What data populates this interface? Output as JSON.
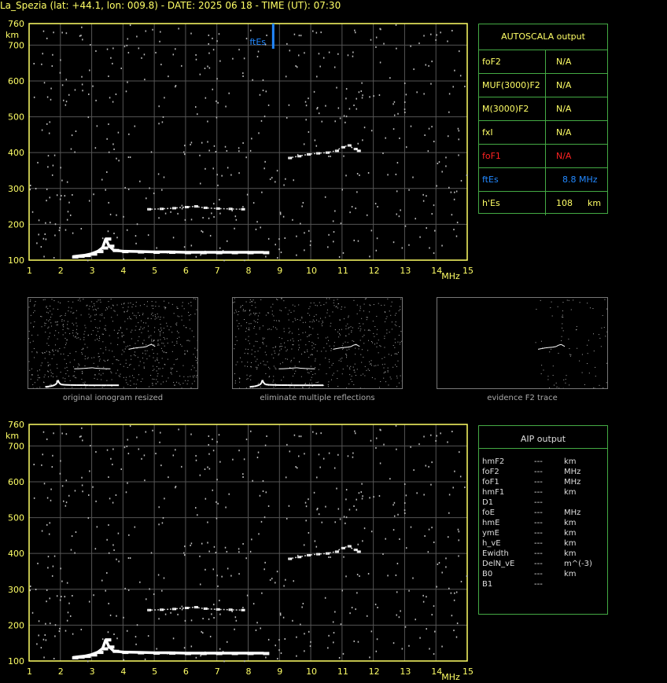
{
  "title": "La_Spezia (lat: +44.1, lon: 009.8) - DATE: 2025 06 18 - TIME (UT): 07:30",
  "colors": {
    "axis": "#ffff66",
    "grid": "#555555",
    "panel_border": "#44aa44",
    "fEs_marker": "#2288ff",
    "foF1_red": "#ff2222"
  },
  "chart_data": [
    {
      "type": "scatter",
      "title": "",
      "xlabel": "MHz",
      "ylabel": "km",
      "xlim": [
        1,
        15
      ],
      "ylim": [
        100,
        760
      ],
      "x_ticks": [
        1,
        2,
        3,
        4,
        5,
        6,
        7,
        8,
        9,
        10,
        11,
        12,
        13,
        14,
        15
      ],
      "y_ticks": [
        100,
        200,
        300,
        400,
        500,
        600,
        700,
        760
      ],
      "grid": true,
      "annotation": {
        "label": "ftEs",
        "x": 8.8
      },
      "series": [
        {
          "trace": "E",
          "x": [
            2.4,
            2.6,
            2.8,
            3.0,
            3.2,
            3.35,
            3.45,
            3.55,
            3.7,
            4.0,
            4.5,
            5.0,
            5.5,
            6.0,
            6.5,
            7.0,
            7.5,
            8.0,
            8.5
          ],
          "y": [
            110,
            112,
            114,
            118,
            125,
            135,
            160,
            140,
            128,
            125,
            124,
            123,
            123,
            122,
            122,
            122,
            122,
            122,
            122
          ]
        },
        {
          "trace": "E2",
          "x": [
            4.8,
            5.2,
            5.6,
            6.0,
            6.3,
            6.6,
            7.0,
            7.4,
            7.8
          ],
          "y": [
            242,
            243,
            245,
            248,
            250,
            246,
            244,
            243,
            242
          ]
        },
        {
          "trace": "F2",
          "x": [
            9.3,
            9.6,
            9.9,
            10.2,
            10.5,
            10.8,
            11.0,
            11.2,
            11.4,
            11.5
          ],
          "y": [
            385,
            390,
            395,
            398,
            400,
            405,
            415,
            420,
            410,
            405
          ]
        }
      ]
    },
    {
      "type": "scatter",
      "title": "",
      "xlabel": "MHz",
      "ylabel": "km",
      "xlim": [
        1,
        15
      ],
      "ylim": [
        100,
        760
      ],
      "x_ticks": [
        1,
        2,
        3,
        4,
        5,
        6,
        7,
        8,
        9,
        10,
        11,
        12,
        13,
        14,
        15
      ],
      "y_ticks": [
        100,
        200,
        300,
        400,
        500,
        600,
        700,
        760
      ],
      "grid": true,
      "series": [
        {
          "trace": "E",
          "x": [
            2.4,
            2.6,
            2.8,
            3.0,
            3.2,
            3.35,
            3.45,
            3.55,
            3.7,
            4.0,
            4.5,
            5.0,
            5.5,
            6.0,
            6.5,
            7.0,
            7.5,
            8.0,
            8.5
          ],
          "y": [
            110,
            112,
            114,
            118,
            125,
            135,
            160,
            140,
            128,
            125,
            124,
            123,
            123,
            122,
            122,
            122,
            122,
            122,
            122
          ]
        },
        {
          "trace": "E2",
          "x": [
            4.8,
            5.2,
            5.6,
            6.0,
            6.3,
            6.6,
            7.0,
            7.4,
            7.8
          ],
          "y": [
            242,
            243,
            245,
            248,
            250,
            246,
            244,
            243,
            242
          ]
        },
        {
          "trace": "F2",
          "x": [
            9.3,
            9.6,
            9.9,
            10.2,
            10.5,
            10.8,
            11.0,
            11.2,
            11.4,
            11.5
          ],
          "y": [
            385,
            390,
            395,
            398,
            400,
            405,
            415,
            420,
            410,
            405
          ]
        }
      ]
    }
  ],
  "autoscala": {
    "header": "AUTOSCALA output",
    "rows": [
      {
        "key": "foF2",
        "value": "N/A",
        "unit": "",
        "color": "#ffff66"
      },
      {
        "key": "MUF(3000)F2",
        "value": "N/A",
        "unit": "",
        "color": "#ffff66"
      },
      {
        "key": "M(3000)F2",
        "value": "N/A",
        "unit": "",
        "color": "#ffff66"
      },
      {
        "key": "fxI",
        "value": "N/A",
        "unit": "",
        "color": "#ffff66"
      },
      {
        "key": "foF1",
        "value": "N/A",
        "unit": "",
        "color": "#ff2222"
      },
      {
        "key": "ftEs",
        "value": "8.8 MHz",
        "unit": "",
        "color": "#2288ff"
      },
      {
        "key": "h'Es",
        "value": "108",
        "unit": "km",
        "color": "#ffff66"
      }
    ]
  },
  "aip": {
    "header": "AIP output",
    "rows": [
      {
        "key": "hmF2",
        "value": "---",
        "unit": "km"
      },
      {
        "key": "foF2",
        "value": "---",
        "unit": "MHz"
      },
      {
        "key": "foF1",
        "value": "---",
        "unit": "MHz"
      },
      {
        "key": "hmF1",
        "value": "---",
        "unit": "km"
      },
      {
        "key": "D1",
        "value": "---",
        "unit": ""
      },
      {
        "key": "foE",
        "value": "---",
        "unit": "MHz"
      },
      {
        "key": "hmE",
        "value": "---",
        "unit": "km"
      },
      {
        "key": "ymE",
        "value": "---",
        "unit": "km"
      },
      {
        "key": "h_vE",
        "value": "---",
        "unit": "km"
      },
      {
        "key": "Ewidth",
        "value": "---",
        "unit": "km"
      },
      {
        "key": "DelN_vE",
        "value": "---",
        "unit": "m^(-3)"
      },
      {
        "key": "B0",
        "value": "---",
        "unit": "km"
      },
      {
        "key": "B1",
        "value": "---",
        "unit": ""
      }
    ]
  },
  "thumbnails": [
    {
      "caption": "original ionogram resized"
    },
    {
      "caption": "eliminate multiple reflections"
    },
    {
      "caption": "evidence F2 trace"
    }
  ]
}
